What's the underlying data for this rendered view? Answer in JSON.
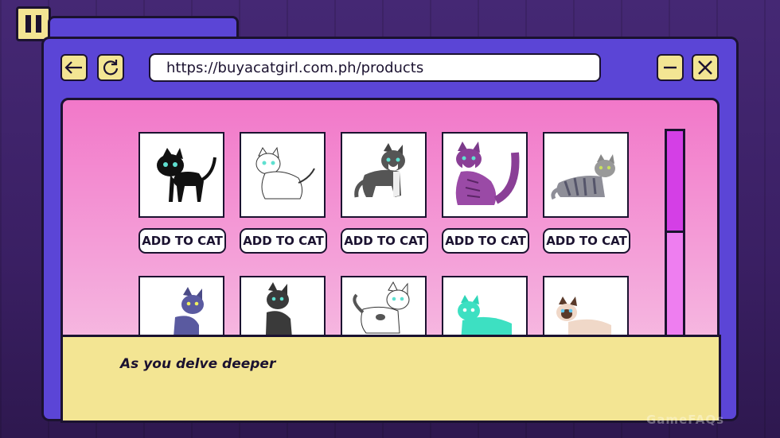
{
  "browser": {
    "url": "https://buyacatgirl.com.ph/products"
  },
  "products": [
    {
      "button_label": "ADD TO CAT",
      "cat": "black-cat"
    },
    {
      "button_label": "ADD TO CAT",
      "cat": "white-cat"
    },
    {
      "button_label": "ADD TO CAT",
      "cat": "gray-white-cat"
    },
    {
      "button_label": "ADD TO CAT",
      "cat": "purple-striped-cat"
    },
    {
      "button_label": "ADD TO CAT",
      "cat": "gray-tabby-cat"
    },
    {
      "cat": "blue-striped-cat"
    },
    {
      "cat": "dark-gray-cat"
    },
    {
      "cat": "white-spotted-cat"
    },
    {
      "cat": "teal-cat"
    },
    {
      "cat": "siamese-cat"
    }
  ],
  "dialog": {
    "text": "As you delve deeper"
  },
  "watermark": "GameFAQs"
}
